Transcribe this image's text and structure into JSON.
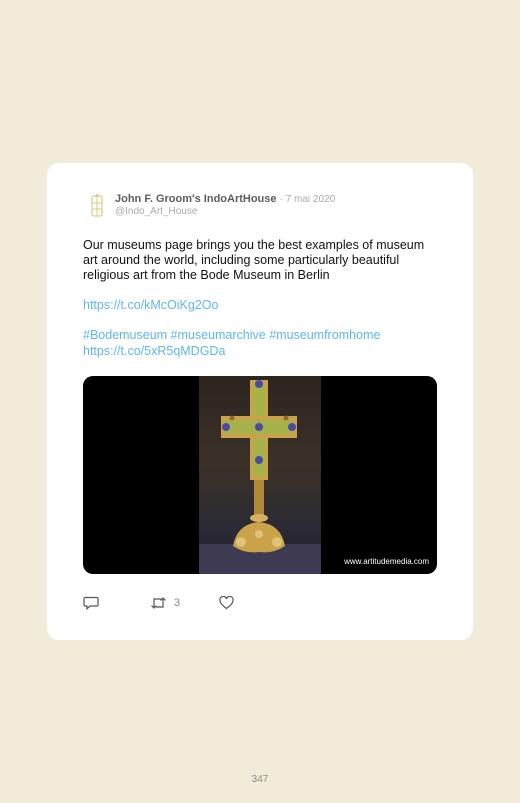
{
  "tweet": {
    "author_name": "John F. Groom's IndoArtHouse",
    "date": "· 7 mai 2020",
    "handle": "@Indo_Art_House",
    "text": "Our museums page brings you the best examples of museum art around the world, including some particularly beautiful religious art from the Bode Museum in Berlin",
    "link1": "https://t.co/kMcOiKg2Oo",
    "hashtags": "#Bodemuseum #museumarchive #museumfromhome",
    "link2": "https://t.co/5xR5qMDGDa",
    "media_watermark": "www.artitudemedia.com",
    "retweet_count": "3"
  },
  "icons": {
    "avatar": "logo-icon",
    "reply": "reply-icon",
    "retweet": "retweet-icon",
    "like": "heart-icon"
  },
  "colors": {
    "page_background": "#f1ebda",
    "card": "#ffffff",
    "link": "#5fb6e8",
    "gold": "#c9a24a"
  },
  "page_number": "347"
}
